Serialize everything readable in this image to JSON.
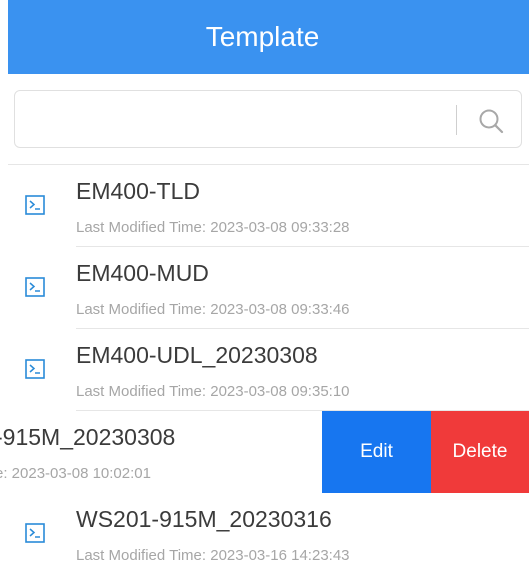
{
  "header": {
    "title": "Template"
  },
  "search": {
    "value": "",
    "placeholder": ""
  },
  "colors": {
    "accent": "#3a92f0",
    "edit": "#1776f0",
    "delete": "#f03a3a"
  },
  "templates": [
    {
      "name": "EM400-TLD",
      "modified": "Last Modified Time: 2023-03-08 09:33:28"
    },
    {
      "name": "EM400-MUD",
      "modified": "Last Modified Time: 2023-03-08 09:33:46"
    },
    {
      "name": "EM400-UDL_20230308",
      "modified": "Last Modified Time: 2023-03-08 09:35:10"
    },
    {
      "name": "-915M_20230308",
      "modified": "e: 2023-03-08 10:02:01"
    },
    {
      "name": "WS201-915M_20230316",
      "modified": "Last Modified Time: 2023-03-16 14:23:43"
    }
  ],
  "swipe_actions": {
    "edit_label": "Edit",
    "delete_label": "Delete"
  },
  "icons": {
    "template": "terminal-icon",
    "search": "search-icon"
  }
}
